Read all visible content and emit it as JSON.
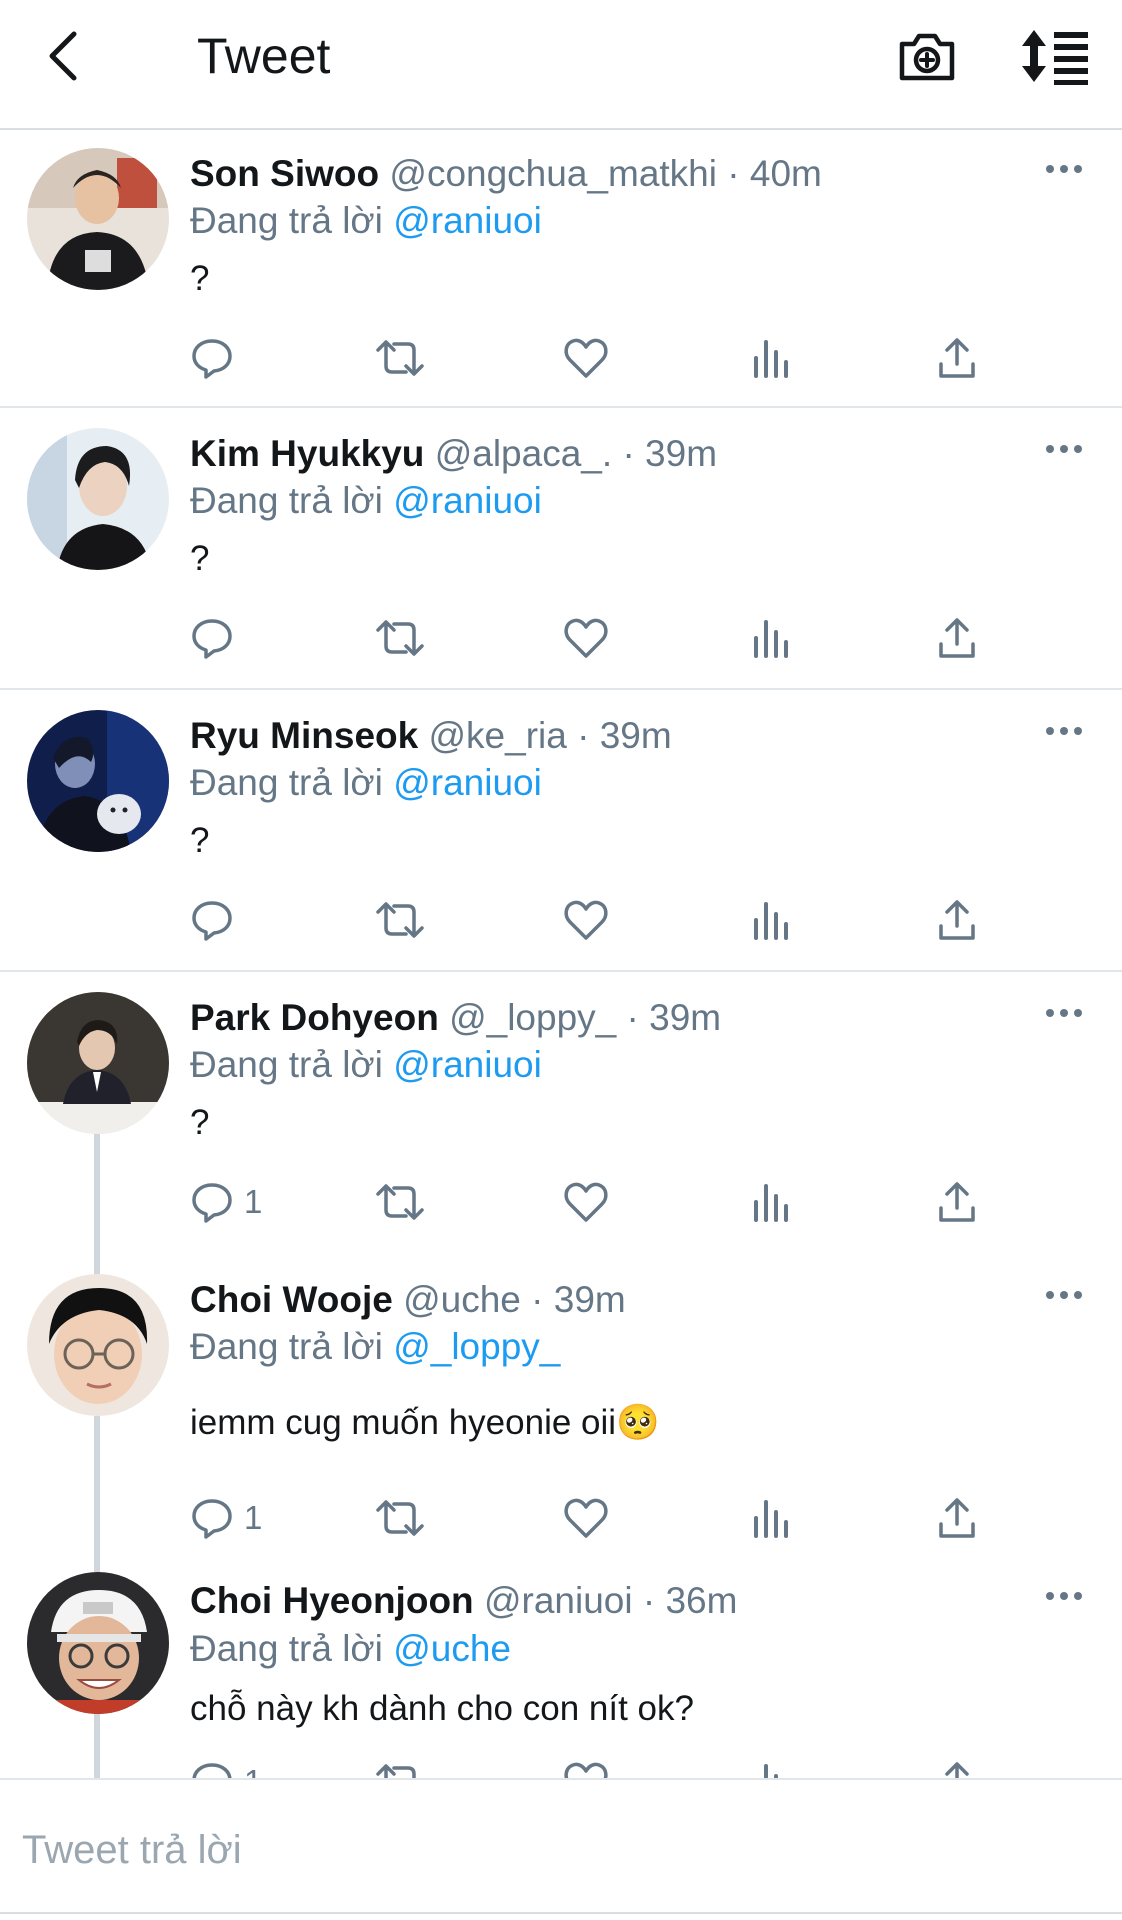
{
  "header": {
    "title": "Tweet",
    "back_icon": "chevron-left-icon",
    "camera_icon": "camera-plus-icon",
    "sort_icon": "sort-list-icon"
  },
  "colors": {
    "link": "#1d9bf0",
    "muted": "#657786",
    "divider": "#e1e6ea",
    "thread_line": "#cfd6dc"
  },
  "tweets": [
    {
      "name": "Son Siwoo",
      "handle": "@congchua_matkhi",
      "separator": "·",
      "time": "40m",
      "reply_prefix": "Đang trả lời",
      "reply_to": "@raniuoi",
      "text": "?",
      "reply_count": ""
    },
    {
      "name": "Kim Hyukkyu",
      "handle": "@alpaca_.",
      "separator": "·",
      "time": "39m",
      "reply_prefix": "Đang trả lời",
      "reply_to": "@raniuoi",
      "text": "?",
      "reply_count": ""
    },
    {
      "name": "Ryu Minseok",
      "handle": "@ke_ria",
      "separator": "·",
      "time": "39m",
      "reply_prefix": "Đang trả lời",
      "reply_to": "@raniuoi",
      "text": "?",
      "reply_count": ""
    },
    {
      "name": "Park Dohyeon",
      "handle": "@_loppy_",
      "separator": "·",
      "time": "39m",
      "reply_prefix": "Đang trả lời",
      "reply_to": "@raniuoi",
      "text": "?",
      "reply_count": "1"
    },
    {
      "name": "Choi Wooje",
      "handle": "@uche",
      "separator": "·",
      "time": "39m",
      "reply_prefix": "Đang trả lời",
      "reply_to": "@_loppy_",
      "text": "iemm cug muốn hyeonie oii🥺",
      "reply_count": "1"
    },
    {
      "name": "Choi Hyeonjoon",
      "handle": "@raniuoi",
      "separator": "·",
      "time": "36m",
      "reply_prefix": "Đang trả lời",
      "reply_to": "@uche",
      "text": "chỗ này kh dành cho con nít ok?",
      "reply_count": "1"
    }
  ],
  "compose": {
    "placeholder": "Tweet trả lời"
  }
}
